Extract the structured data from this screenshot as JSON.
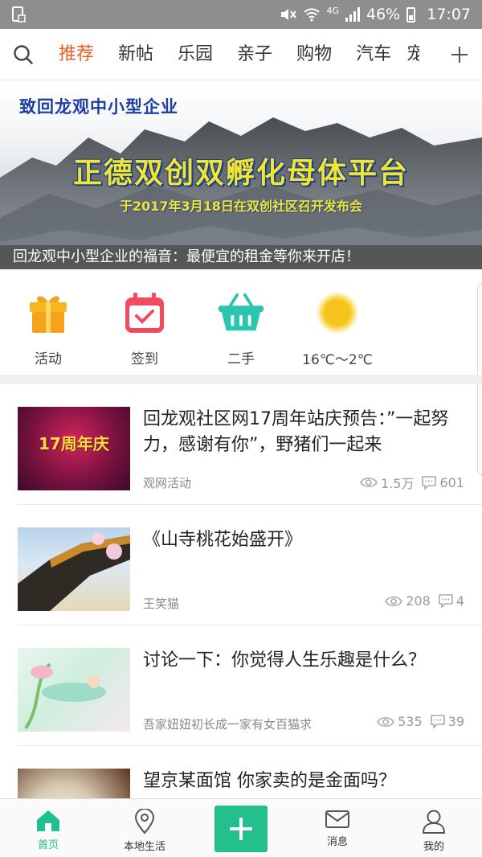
{
  "status_bar": {
    "battery": "46%",
    "network": "4G",
    "time": "17:07"
  },
  "top_nav": {
    "tabs": [
      {
        "label": "推荐",
        "active": true
      },
      {
        "label": "新帖"
      },
      {
        "label": "乐园"
      },
      {
        "label": "亲子"
      },
      {
        "label": "购物"
      },
      {
        "label": "汽车"
      }
    ],
    "clipped_tab": "宠",
    "more_icon": "plus-icon",
    "search_icon": "search-icon"
  },
  "banner": {
    "heading": "致回龙观中小型企业",
    "title": "正德双创双孵化母体平台",
    "subtitle": "于2017年3月18日在双创社区召开发布会",
    "caption": "回龙观中小型企业的福音：最便宜的租金等你来开店！"
  },
  "quick_actions": [
    {
      "label": "活动",
      "icon": "gift-icon",
      "color": "#f7a21b"
    },
    {
      "label": "签到",
      "icon": "calendar-check-icon",
      "color": "#f04b5e"
    },
    {
      "label": "二手",
      "icon": "basket-icon",
      "color": "#2cc6b0"
    },
    {
      "label": "16℃～2℃",
      "icon": "sun-icon",
      "color": "#f7c21b"
    }
  ],
  "posts": [
    {
      "title": "回龙观社区网17周年站庆预告：”一起努力，感谢有你”，野猪们一起来",
      "meta": "观网活动",
      "views": "1.5万",
      "comments": "601",
      "thumb_text": "17周年庆"
    },
    {
      "title": "《山寺桃花始盛开》",
      "meta": "王笑猫",
      "views": "208",
      "comments": "4"
    },
    {
      "title": "讨论一下：你觉得人生乐趣是什么？",
      "meta": "吾家妞妞初长成一家有女百猫求",
      "views": "535",
      "comments": "39"
    },
    {
      "title": "望京某面馆 你家卖的是金面吗？",
      "meta": "",
      "views": "",
      "comments": ""
    }
  ],
  "bottom_nav": [
    {
      "label": "首页",
      "icon": "home-icon",
      "active": true
    },
    {
      "label": "本地生活",
      "icon": "location-pin-icon"
    },
    {
      "label": "",
      "icon": "add-icon"
    },
    {
      "label": "消息",
      "icon": "mail-icon"
    },
    {
      "label": "我的",
      "icon": "user-icon"
    }
  ],
  "colors": {
    "accent": "#f05a22",
    "brand_green": "#23c08e",
    "status_bar": "#8e8e8e"
  }
}
